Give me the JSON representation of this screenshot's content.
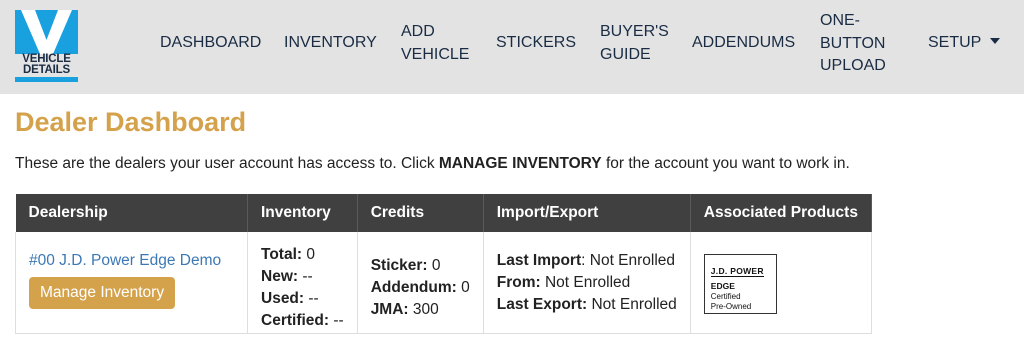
{
  "brand": {
    "line1": "VEHICLE",
    "line2": "DETAILS",
    "accent": "#19a0df",
    "dark": "#1a2c44"
  },
  "nav": {
    "dashboard": "DASHBOARD",
    "inventory": "INVENTORY",
    "add_vehicle_1": "ADD",
    "add_vehicle_2": "VEHICLE",
    "stickers": "STICKERS",
    "buyers_guide_1": "BUYER'S",
    "buyers_guide_2": "GUIDE",
    "addendums": "ADDENDUMS",
    "one_button_1": "ONE-",
    "one_button_2": "BUTTON",
    "one_button_3": "UPLOAD",
    "setup": "SETUP"
  },
  "page": {
    "title": "Dealer Dashboard",
    "intro_before": "These are the dealers your user account has access to. Click ",
    "intro_bold": "MANAGE INVENTORY",
    "intro_after": " for the account you want to work in."
  },
  "table": {
    "headers": [
      "Dealership",
      "Inventory",
      "Credits",
      "Import/Export",
      "Associated Products"
    ],
    "row": {
      "dealer_name": "#00 J.D. Power Edge Demo",
      "manage_button": "Manage Inventory",
      "inventory": {
        "total_label": "Total:",
        "total_value": " 0",
        "new_label": "New:",
        "new_value": " --",
        "used_label": "Used:",
        "used_value": " --",
        "certified_label": "Certified:",
        "certified_value": " --"
      },
      "credits": {
        "sticker_label": "Sticker:",
        "sticker_value": " 0",
        "addendum_label": "Addendum:",
        "addendum_value": " 0",
        "jma_label": "JMA:",
        "jma_value": " 300"
      },
      "import_export": {
        "last_import_label": "Last Import",
        "last_import_value": ": Not Enrolled",
        "from_label": "From:",
        "from_value": " Not Enrolled",
        "last_export_label": "Last Export:",
        "last_export_value": " Not Enrolled"
      },
      "product_logo": {
        "line1": "J.D. POWER",
        "line2": "EDGE",
        "line3": "Certified",
        "line4": "Pre-Owned"
      }
    }
  },
  "colors": {
    "title": "#d5a24c",
    "button": "#d5a24c",
    "link": "#3c78b5",
    "header_bg": "#404040",
    "navbar_bg": "#e3e3e3"
  }
}
